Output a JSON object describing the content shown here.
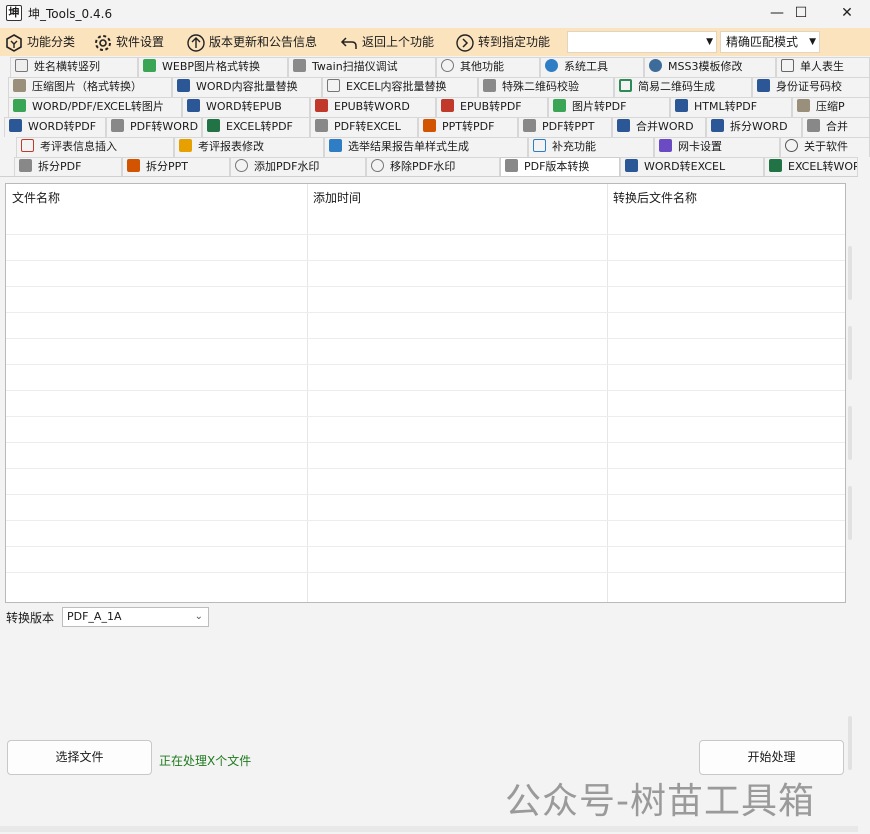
{
  "window": {
    "title": "坤_Tools_0.4.6",
    "minimize": "—",
    "maximize": "☐",
    "close": "✕"
  },
  "toolbar": {
    "items": [
      "功能分类",
      "软件设置",
      "版本更新和公告信息",
      "返回上个功能",
      "转到指定功能"
    ],
    "search_value": "",
    "match_mode": "精确匹配模式"
  },
  "tabs": {
    "row1": [
      "姓名横转竖列",
      "WEBP图片格式转换",
      "Twain扫描仪调试",
      "其他功能",
      "系统工具",
      "MSS3模板修改",
      "单人表生"
    ],
    "row2": [
      "压缩图片（格式转换）",
      "WORD内容批量替换",
      "EXCEL内容批量替换",
      "特殊二维码校验",
      "简易二维码生成",
      "身份证号码校"
    ],
    "row3": [
      "WORD/PDF/EXCEL转图片",
      "WORD转EPUB",
      "EPUB转WORD",
      "EPUB转PDF",
      "图片转PDF",
      "HTML转PDF",
      "压缩P"
    ],
    "row4": [
      "WORD转PDF",
      "PDF转WORD",
      "EXCEL转PDF",
      "PDF转EXCEL",
      "PPT转PDF",
      "PDF转PPT",
      "合并WORD",
      "拆分WORD",
      "合并"
    ],
    "row5": [
      "考评表信息插入",
      "考评报表修改",
      "选举结果报告单样式生成",
      "补充功能",
      "网卡设置",
      "关于软件"
    ],
    "row6": [
      "拆分PDF",
      "拆分PPT",
      "添加PDF水印",
      "移除PDF水印",
      "PDF版本转换",
      "WORD转EXCEL",
      "EXCEL转WOR"
    ],
    "active": "PDF版本转换"
  },
  "grid": {
    "columns": [
      "文件名称",
      "添加时间",
      "转换后文件名称"
    ],
    "rows": []
  },
  "version": {
    "label": "转换版本",
    "value": "PDF_A_1A"
  },
  "buttons": {
    "select_files": "选择文件",
    "start": "开始处理"
  },
  "status_text": "正在处理X个文件",
  "watermark": "公众号-树苗工具箱",
  "colors": {
    "toolbar_bg": "#fbe3bd",
    "status_green": "#1f7a1f"
  }
}
